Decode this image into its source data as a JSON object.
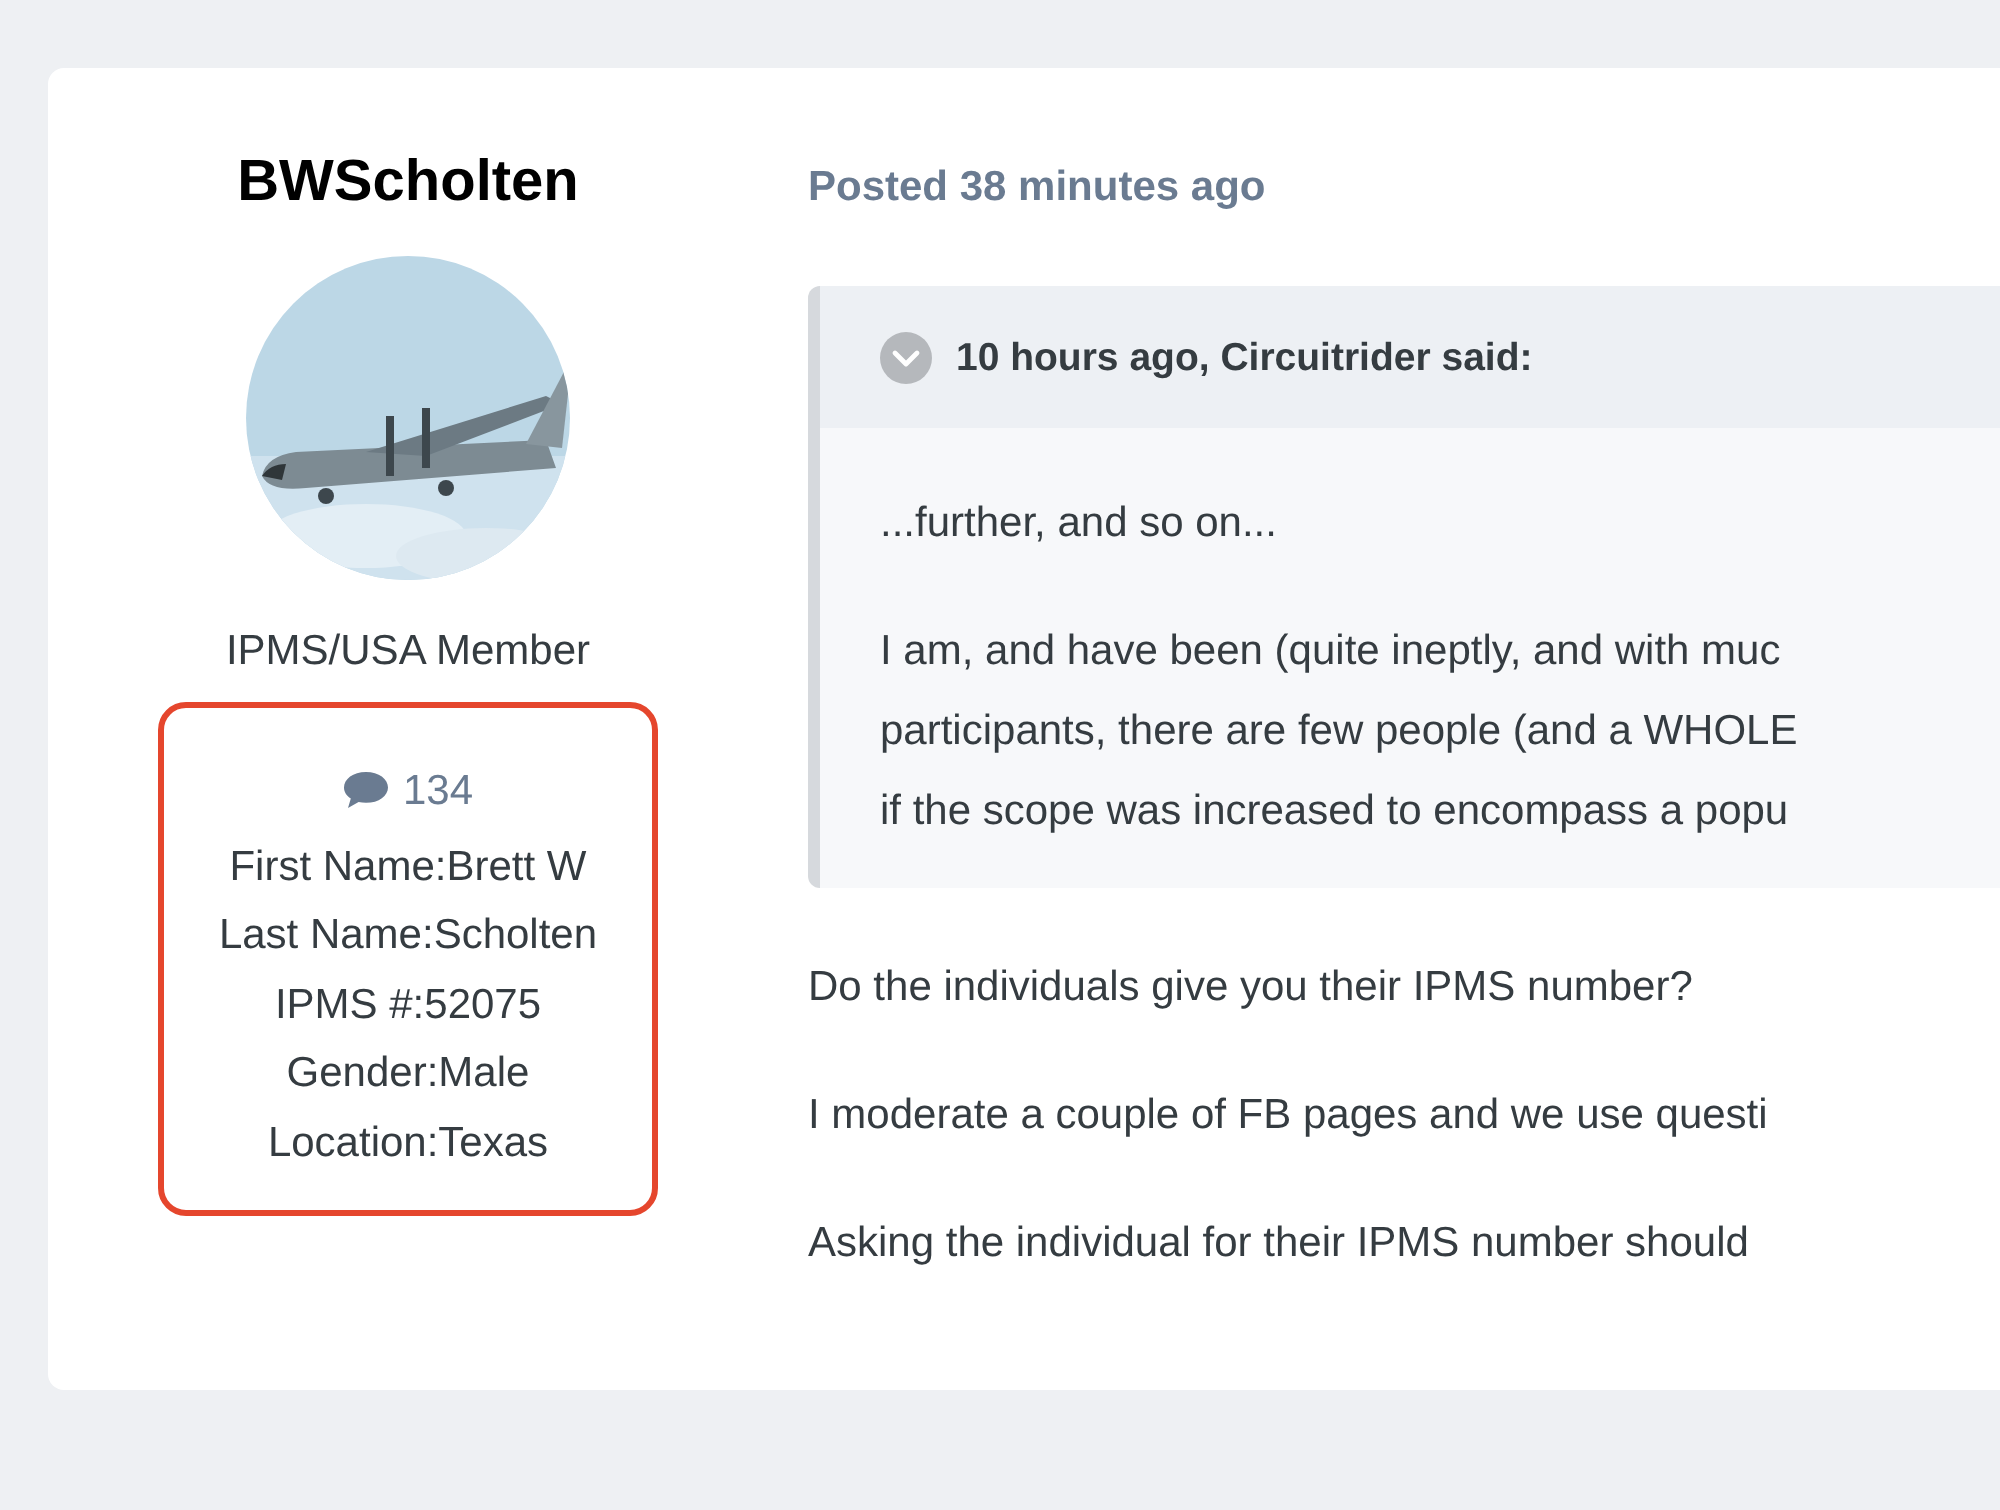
{
  "author": {
    "name": "BWScholten",
    "group": "IPMS/USA Member",
    "post_count": "134",
    "fields": [
      "First Name:Brett W",
      "Last Name:Scholten",
      "IPMS #:52075",
      "Gender:Male",
      "Location:Texas"
    ]
  },
  "post": {
    "posted": "Posted 38 minutes ago",
    "quote": {
      "citation": "10 hours ago, Circuitrider said:",
      "expanded": true,
      "paragraphs": [
        [
          "...further, and so on..."
        ],
        [
          "I am, and have been (quite ineptly, and with muc",
          "participants, there are few people (and a WHOLE",
          "if the scope was increased to encompass a popu"
        ]
      ]
    },
    "paragraphs": [
      [
        "Do the individuals give you their IPMS number?"
      ],
      [
        "I moderate a couple of FB pages and we use questi"
      ],
      [
        "Asking the individual for their IPMS number should"
      ]
    ]
  }
}
